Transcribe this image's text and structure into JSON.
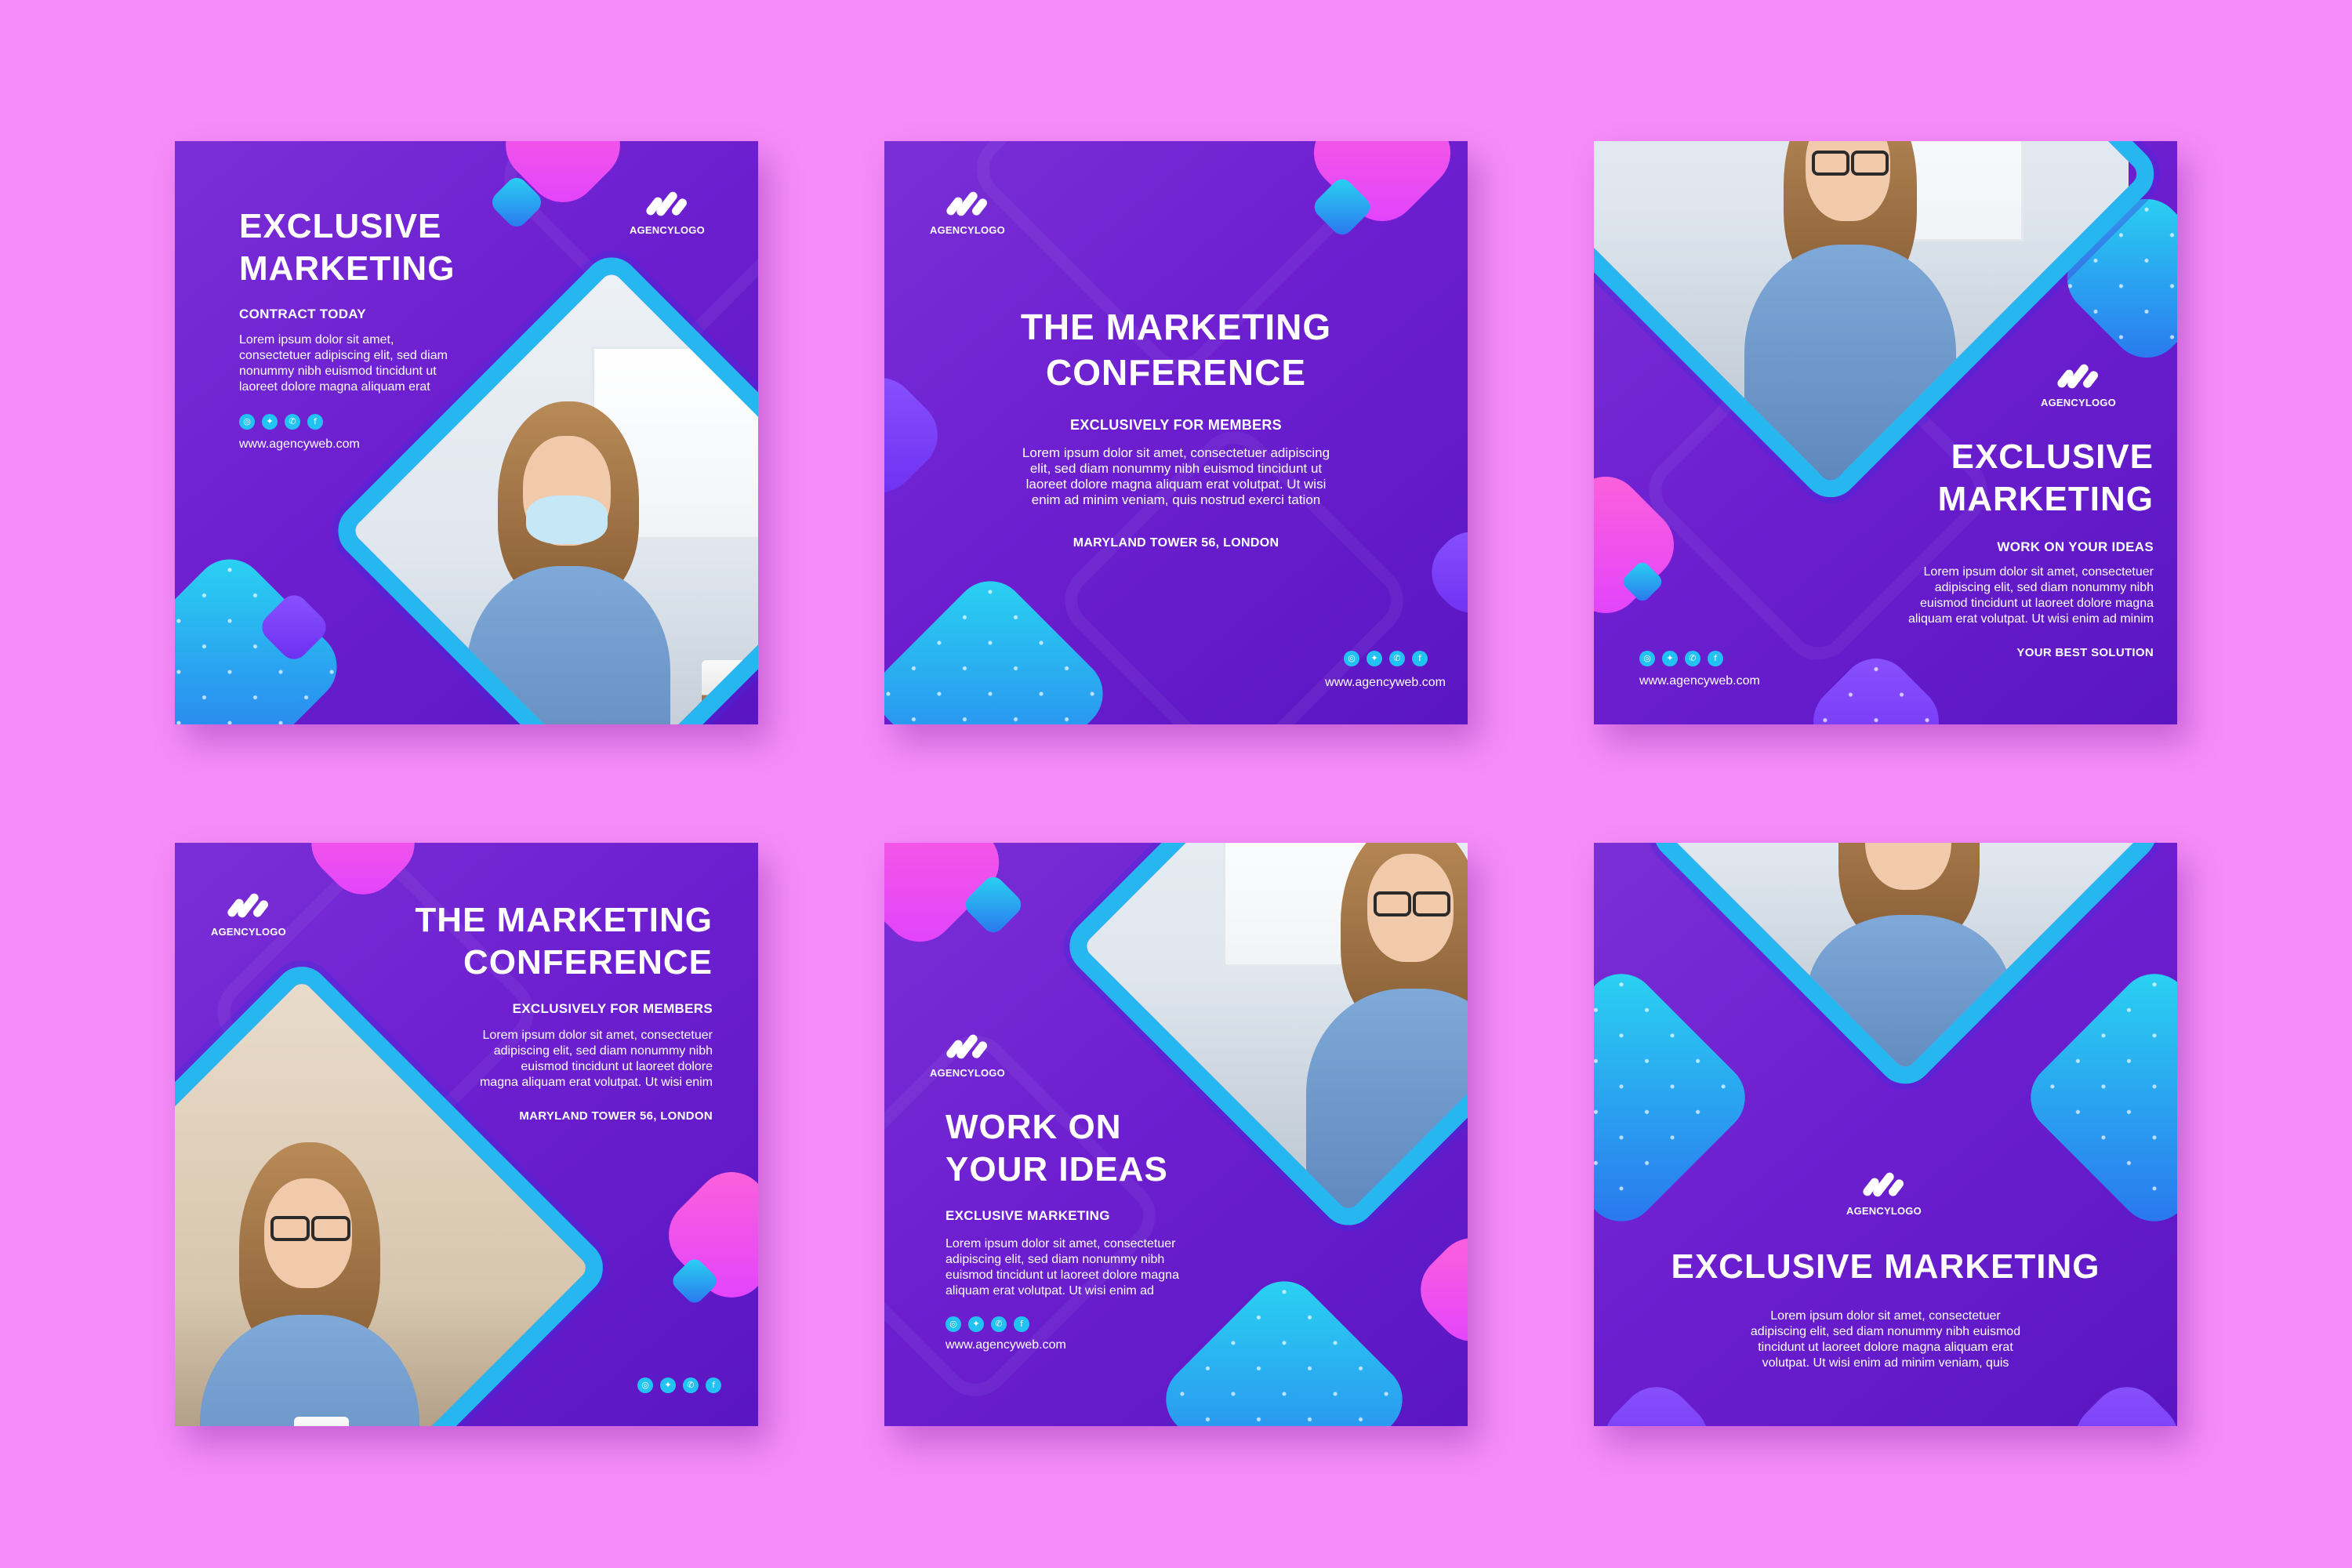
{
  "colors": {
    "background": "#f58cf9",
    "post_purple": "#6d1fd0",
    "pink": "#ff63d8",
    "cyan": "#2ad6f2",
    "accent_blue": "#27b7f0"
  },
  "logo_text": "AGENCYLOGO",
  "social_icons": [
    "instagram-icon",
    "twitter-icon",
    "whatsapp-icon",
    "facebook-icon"
  ],
  "social_glyphs": [
    "◎",
    "✦",
    "✆",
    "f"
  ],
  "posts": [
    {
      "title_line1": "EXCLUSIVE",
      "title_line2": "MARKETING",
      "subtitle": "CONTRACT TODAY",
      "body": [
        "Lorem ipsum dolor sit amet,",
        "consectetuer adipiscing elit, sed diam",
        "nonummy nibh euismod tincidunt ut",
        "laoreet dolore magna aliquam erat"
      ],
      "url": "www.agencyweb.com"
    },
    {
      "title_line1": "THE MARKETING",
      "title_line2": "CONFERENCE",
      "subtitle": "EXCLUSIVELY FOR MEMBERS",
      "body": [
        "Lorem ipsum dolor sit amet, consectetuer adipiscing",
        "elit, sed diam nonummy nibh euismod tincidunt ut",
        "laoreet dolore magna aliquam erat volutpat. Ut wisi",
        "enim ad minim veniam, quis nostrud exerci tation"
      ],
      "location": "MARYLAND TOWER 56, LONDON",
      "url": "www.agencyweb.com"
    },
    {
      "title_line1": "EXCLUSIVE",
      "title_line2": "MARKETING",
      "subtitle": "WORK ON YOUR IDEAS",
      "body": [
        "Lorem ipsum dolor sit amet, consectetuer",
        "adipiscing elit, sed diam nonummy nibh",
        "euismod tincidunt ut laoreet dolore magna",
        "aliquam erat volutpat. Ut wisi enim ad minim"
      ],
      "tagline": "YOUR BEST SOLUTION",
      "url": "www.agencyweb.com"
    },
    {
      "title_line1": "THE MARKETING",
      "title_line2": "CONFERENCE",
      "subtitle": "EXCLUSIVELY FOR MEMBERS",
      "body": [
        "Lorem ipsum dolor sit amet, consectetuer",
        "adipiscing elit, sed diam nonummy nibh",
        "euismod tincidunt ut laoreet dolore",
        "magna aliquam erat volutpat. Ut wisi enim"
      ],
      "location": "MARYLAND TOWER 56, LONDON"
    },
    {
      "title_line1": "WORK ON",
      "title_line2": "YOUR IDEAS",
      "subtitle": "EXCLUSIVE MARKETING",
      "body": [
        "Lorem ipsum dolor sit amet, consectetuer",
        "adipiscing elit, sed diam nonummy nibh",
        "euismod tincidunt ut laoreet dolore magna",
        "aliquam erat volutpat. Ut wisi enim ad"
      ],
      "url": "www.agencyweb.com"
    },
    {
      "title": "EXCLUSIVE MARKETING",
      "body": [
        "Lorem ipsum dolor sit amet, consectetuer",
        "adipiscing elit, sed diam nonummy nibh euismod",
        "tincidunt ut laoreet dolore magna aliquam erat",
        "volutpat. Ut wisi enim ad minim veniam, quis"
      ]
    }
  ]
}
